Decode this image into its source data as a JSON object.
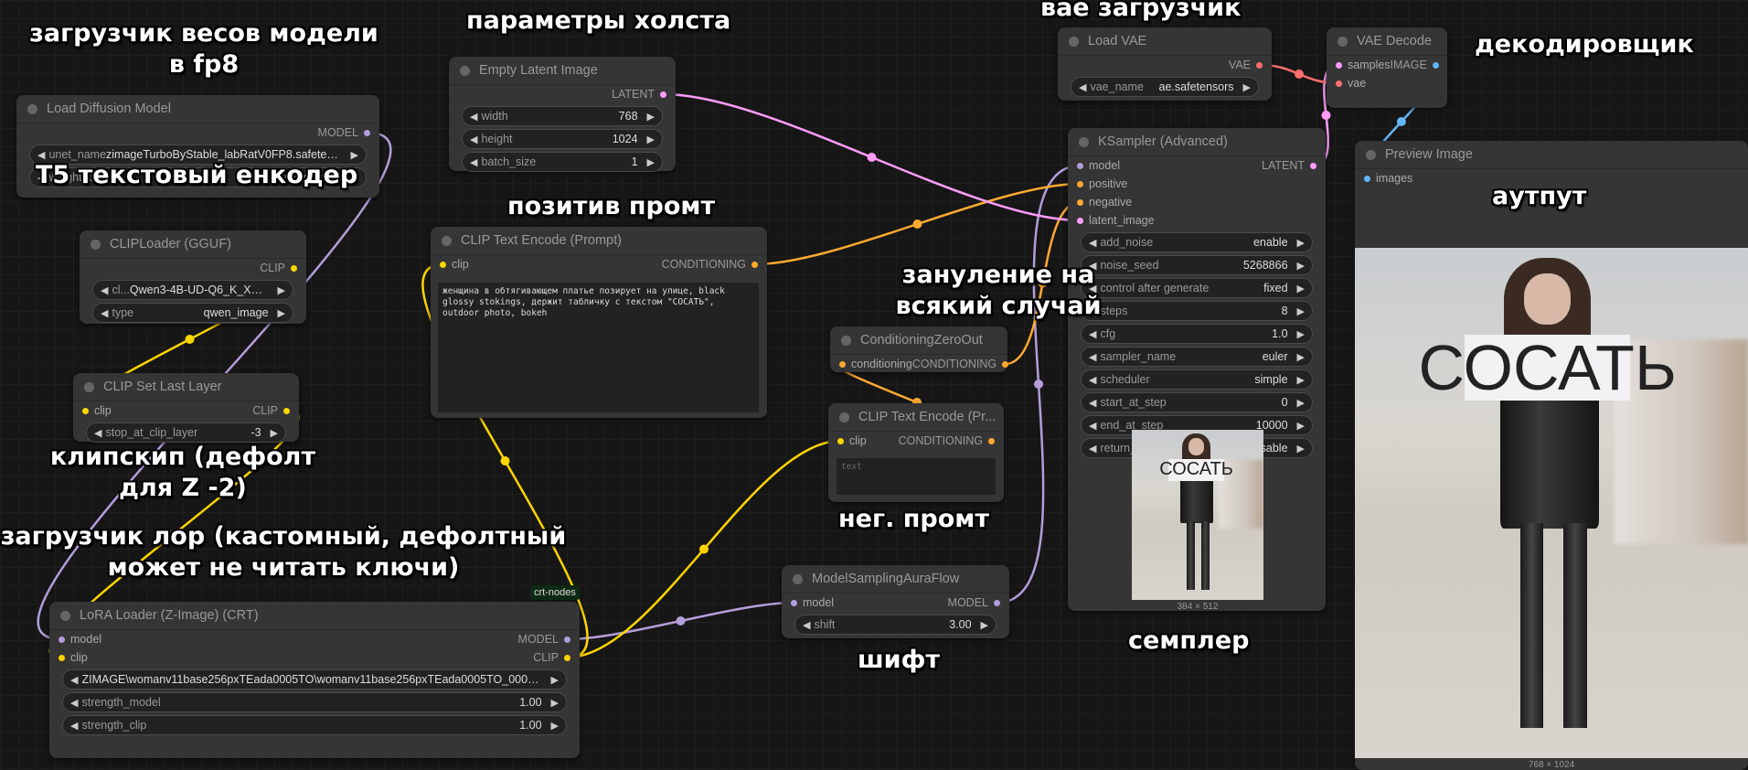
{
  "colors": {
    "MODEL": "#b39ddb",
    "CLIP": "#ffd500",
    "CONDITIONING": "#ffa931",
    "LATENT": "#ff9cf9",
    "VAE": "#ff6e6e",
    "IMAGE": "#64b5f6"
  },
  "nodes": [
    {
      "id": "ld",
      "title": "Load Diffusion Model",
      "inputs": [],
      "outputs": [
        {
          "name": "MODEL",
          "type": "MODEL"
        }
      ],
      "widgets": [
        {
          "label": "unet_name",
          "value": "zimageTurboByStable_labRatV0FP8.safetensors"
        },
        {
          "label": "weight_dtype",
          "value": "fp8_e4m3fn"
        }
      ]
    },
    {
      "id": "cl",
      "title": "CLIPLoader (GGUF)",
      "inputs": [],
      "outputs": [
        {
          "name": "CLIP",
          "type": "CLIP"
        }
      ],
      "widgets": [
        {
          "label": "cl...",
          "value": "Qwen3-4B-UD-Q6_K_XL.gguf"
        },
        {
          "label": "type",
          "value": "qwen_image"
        }
      ]
    },
    {
      "id": "csl",
      "title": "CLIP Set Last Layer",
      "inputs": [
        {
          "name": "clip",
          "type": "CLIP"
        }
      ],
      "outputs": [
        {
          "name": "CLIP",
          "type": "CLIP"
        }
      ],
      "widgets": [
        {
          "label": "stop_at_clip_layer",
          "value": "-3"
        }
      ]
    },
    {
      "id": "lora",
      "title": "LoRA Loader (Z-Image) (CRT)",
      "badge": "crt-nodes",
      "inputs": [
        {
          "name": "model",
          "type": "MODEL"
        },
        {
          "name": "clip",
          "type": "CLIP"
        }
      ],
      "outputs": [
        {
          "name": "MODEL",
          "type": "MODEL"
        },
        {
          "name": "CLIP",
          "type": "CLIP"
        }
      ],
      "widgets": [
        {
          "label": "",
          "value": "ZIMAGE\\womanv11base256pxTEada0005TO\\womanv11base256pxTEada0005TO_000002000.safe..."
        },
        {
          "label": "strength_model",
          "value": "1.00"
        },
        {
          "label": "strength_clip",
          "value": "1.00"
        }
      ]
    },
    {
      "id": "eli",
      "title": "Empty Latent Image",
      "inputs": [],
      "outputs": [
        {
          "name": "LATENT",
          "type": "LATENT"
        }
      ],
      "widgets": [
        {
          "label": "width",
          "value": "768"
        },
        {
          "label": "height",
          "value": "1024"
        },
        {
          "label": "batch_size",
          "value": "1"
        }
      ]
    },
    {
      "id": "pos",
      "title": "CLIP Text Encode (Prompt)",
      "inputs": [
        {
          "name": "clip",
          "type": "CLIP"
        }
      ],
      "outputs": [
        {
          "name": "CONDITIONING",
          "type": "CONDITIONING"
        }
      ],
      "widgets": [],
      "text": "женщина в обтягивающем платье позирует на улице, black glossy stokings, держит табличку с текстом \"СОСАТЬ\", outdoor photo, bokeh"
    },
    {
      "id": "czo",
      "title": "ConditioningZeroOut",
      "inputs": [
        {
          "name": "conditioning",
          "type": "CONDITIONING"
        }
      ],
      "outputs": [
        {
          "name": "CONDITIONING",
          "type": "CONDITIONING"
        }
      ],
      "widgets": []
    },
    {
      "id": "neg",
      "title": "CLIP Text Encode (Pr...",
      "inputs": [
        {
          "name": "clip",
          "type": "CLIP"
        }
      ],
      "outputs": [
        {
          "name": "CONDITIONING",
          "type": "CONDITIONING"
        }
      ],
      "widgets": [],
      "text": "",
      "placeholder": "text"
    },
    {
      "id": "msaf",
      "title": "ModelSamplingAuraFlow",
      "inputs": [
        {
          "name": "model",
          "type": "MODEL"
        }
      ],
      "outputs": [
        {
          "name": "MODEL",
          "type": "MODEL"
        }
      ],
      "widgets": [
        {
          "label": "shift",
          "value": "3.00"
        }
      ]
    },
    {
      "id": "vae",
      "title": "Load VAE",
      "inputs": [],
      "outputs": [
        {
          "name": "VAE",
          "type": "VAE"
        }
      ],
      "widgets": [
        {
          "label": "vae_name",
          "value": "ae.safetensors"
        }
      ]
    },
    {
      "id": "vaed",
      "title": "VAE Decode",
      "inputs": [
        {
          "name": "samples",
          "type": "LATENT"
        },
        {
          "name": "vae",
          "type": "VAE"
        }
      ],
      "outputs": [
        {
          "name": "IMAGE",
          "type": "IMAGE"
        }
      ],
      "widgets": []
    },
    {
      "id": "ks",
      "title": "KSampler (Advanced)",
      "inputs": [
        {
          "name": "model",
          "type": "MODEL"
        },
        {
          "name": "positive",
          "type": "CONDITIONING"
        },
        {
          "name": "negative",
          "type": "CONDITIONING"
        },
        {
          "name": "latent_image",
          "type": "LATENT"
        }
      ],
      "outputs": [
        {
          "name": "LATENT",
          "type": "LATENT"
        }
      ],
      "widgets": [
        {
          "label": "add_noise",
          "value": "enable"
        },
        {
          "label": "noise_seed",
          "value": "5268866"
        },
        {
          "label": "control after generate",
          "value": "fixed"
        },
        {
          "label": "steps",
          "value": "8"
        },
        {
          "label": "cfg",
          "value": "1.0"
        },
        {
          "label": "sampler_name",
          "value": "euler"
        },
        {
          "label": "scheduler",
          "value": "simple"
        },
        {
          "label": "start_at_step",
          "value": "0"
        },
        {
          "label": "end_at_step",
          "value": "10000"
        },
        {
          "label": "return_with_leftover_noise",
          "value": "disable"
        }
      ],
      "preview_size": "384 × 512",
      "sign_text": "СОСАТЬ"
    },
    {
      "id": "prev",
      "title": "Preview Image",
      "inputs": [
        {
          "name": "images",
          "type": "IMAGE"
        }
      ],
      "outputs": [],
      "widgets": [],
      "preview_size": "768 × 1024",
      "sign_text": "СОСАТЬ"
    }
  ],
  "links": [
    [
      "ld",
      0,
      "lora",
      0,
      "MODEL"
    ],
    [
      "cl",
      0,
      "csl",
      0,
      "CLIP"
    ],
    [
      "csl",
      0,
      "lora",
      1,
      "CLIP"
    ],
    [
      "lora",
      0,
      "msaf",
      0,
      "MODEL"
    ],
    [
      "lora",
      1,
      "pos",
      0,
      "CLIP"
    ],
    [
      "lora",
      1,
      "neg",
      0,
      "CLIP"
    ],
    [
      "msaf",
      0,
      "ks",
      0,
      "MODEL"
    ],
    [
      "pos",
      0,
      "ks",
      1,
      "CONDITIONING"
    ],
    [
      "neg",
      0,
      "czo",
      0,
      "CONDITIONING"
    ],
    [
      "czo",
      0,
      "ks",
      2,
      "CONDITIONING"
    ],
    [
      "eli",
      0,
      "ks",
      3,
      "LATENT"
    ],
    [
      "ks",
      0,
      "vaed",
      0,
      "LATENT"
    ],
    [
      "vae",
      0,
      "vaed",
      1,
      "VAE"
    ],
    [
      "vaed",
      0,
      "prev",
      0,
      "IMAGE"
    ]
  ],
  "annotations": [
    {
      "id": "a1",
      "lines": [
        "загрузчик весов модели",
        "в fp8"
      ]
    },
    {
      "id": "a2",
      "lines": [
        "T5 текстовый енкодер"
      ]
    },
    {
      "id": "a3",
      "lines": [
        "параметры холста"
      ]
    },
    {
      "id": "a4",
      "lines": [
        "позитив промт"
      ]
    },
    {
      "id": "a5",
      "lines": [
        "вае загрузчик"
      ]
    },
    {
      "id": "a6",
      "lines": [
        "декодировщик"
      ]
    },
    {
      "id": "a7",
      "lines": [
        "аутпут"
      ]
    },
    {
      "id": "a8",
      "lines": [
        "зануление на",
        "всякий случай"
      ]
    },
    {
      "id": "a9",
      "lines": [
        "нег. промт"
      ]
    },
    {
      "id": "a10",
      "lines": [
        "клипскип (дефолт",
        "для Z -2)"
      ]
    },
    {
      "id": "a11",
      "lines": [
        "загрузчик лор (кастомный, дефолтный",
        "может не читать ключи)"
      ]
    },
    {
      "id": "a12",
      "lines": [
        "шифт"
      ]
    },
    {
      "id": "a13",
      "lines": [
        "семплер"
      ]
    }
  ]
}
